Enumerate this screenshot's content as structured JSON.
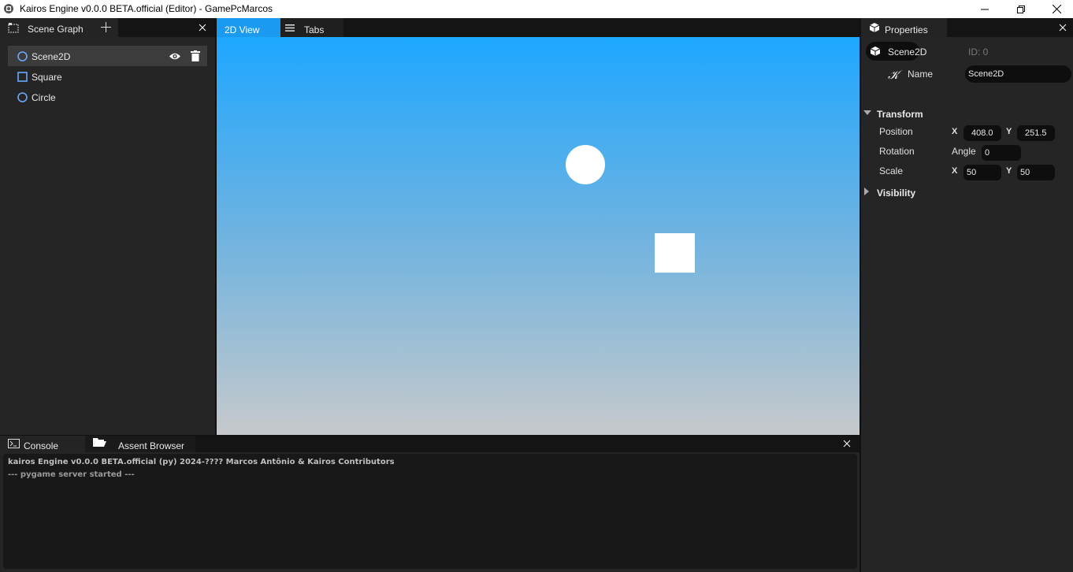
{
  "window": {
    "title": "Kairos Engine v0.0.0 BETA.official (Editor) - GamePcMarcos",
    "minimize_icon": "minimize-icon",
    "restore_icon": "restore-icon",
    "close_icon": "close-icon"
  },
  "scene_graph": {
    "tab_label": "Scene Graph",
    "add_icon": "plus-icon",
    "items": [
      {
        "label": "Scene2D",
        "icon": "circle-outline-icon",
        "selected": true
      },
      {
        "label": "Square",
        "icon": "square-outline-icon",
        "selected": false
      },
      {
        "label": "Circle",
        "icon": "circle-outline-icon",
        "selected": false
      }
    ]
  },
  "viewport": {
    "tabs": [
      {
        "label": "2D View",
        "active": true
      },
      {
        "label": "Tabs",
        "active": false,
        "icon": "hamburger-icon"
      }
    ],
    "colors": {
      "sky_top": "#1ea7ff",
      "sky_bottom": "#c6c9cb",
      "shape": "#ffffff"
    }
  },
  "properties": {
    "tab_label": "Properties",
    "object_name": "Scene2D",
    "id_label": "ID: 0",
    "name_label": "Name",
    "name_value": "Scene2D",
    "transform_label": "Transform",
    "position_label": "Position",
    "position_x_axis": "X",
    "position_x": "408.0",
    "position_y_axis": "Y",
    "position_y": "251.5",
    "rotation_label": "Rotation",
    "angle_label": "Angle",
    "angle_value": "0",
    "scale_label": "Scale",
    "scale_x_axis": "X",
    "scale_x": "50",
    "scale_y_axis": "Y",
    "scale_y": "50",
    "visibility_label": "Visibility"
  },
  "bottom": {
    "tabs": [
      {
        "label": "Console",
        "active": true
      },
      {
        "label": "Assent Browser",
        "active": false
      }
    ],
    "console_lines": [
      "kairos Engine v0.0.0 BETA.official (py) 2024-???? Marcos Antônio & Kairos Contributors",
      "--- pygame server started ---"
    ]
  }
}
